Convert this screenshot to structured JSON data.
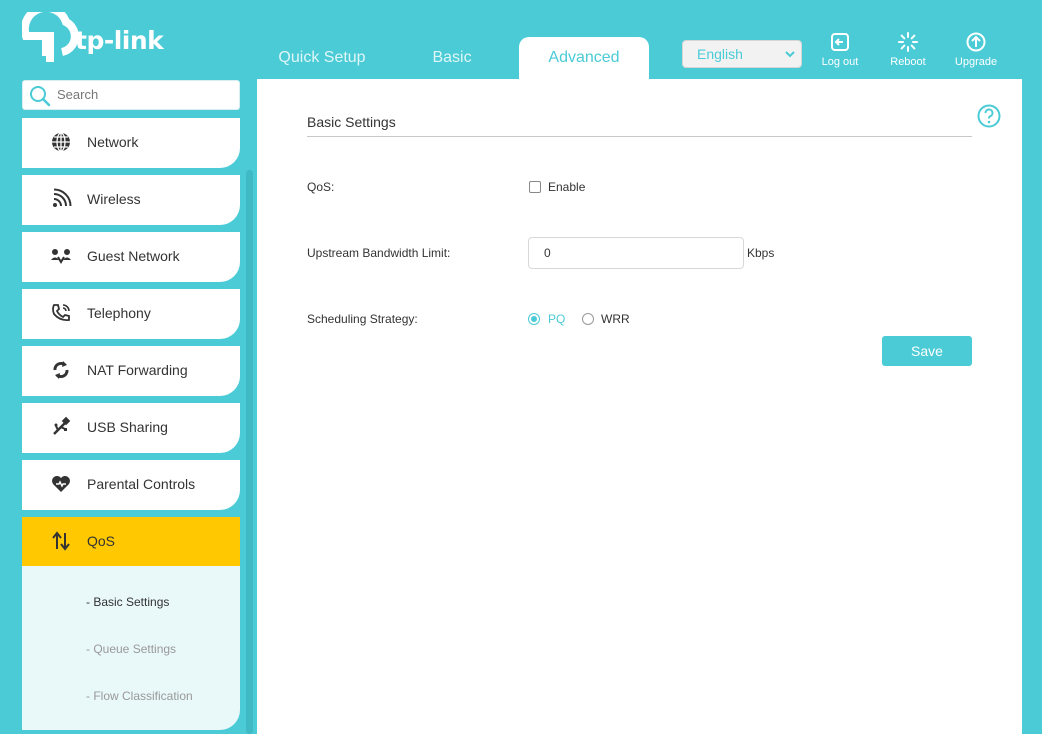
{
  "brand": {
    "logo_text": "tp-link",
    "accent": "#4acbd6",
    "active_nav": "#ffc800"
  },
  "tabs": [
    {
      "label": "Quick Setup"
    },
    {
      "label": "Basic"
    },
    {
      "label": "Advanced",
      "active": true
    }
  ],
  "header": {
    "language": "English",
    "logout_label": "Log out",
    "reboot_label": "Reboot",
    "upgrade_label": "Upgrade"
  },
  "sidebar": {
    "search_placeholder": "Search",
    "items": [
      {
        "label": "Network",
        "icon": "globe-icon"
      },
      {
        "label": "Wireless",
        "icon": "wifi-icon"
      },
      {
        "label": "Guest Network",
        "icon": "guest-network-icon"
      },
      {
        "label": "Telephony",
        "icon": "phone-icon"
      },
      {
        "label": "NAT Forwarding",
        "icon": "nat-forwarding-icon"
      },
      {
        "label": "USB Sharing",
        "icon": "usb-icon"
      },
      {
        "label": "Parental Controls",
        "icon": "heart-icon"
      },
      {
        "label": "QoS",
        "icon": "updown-arrows-icon",
        "active": true
      }
    ],
    "sub_items": [
      {
        "label": "- Basic Settings",
        "active": true
      },
      {
        "label": "- Queue Settings"
      },
      {
        "label": "- Flow Classification"
      }
    ]
  },
  "main": {
    "section_title": "Basic Settings",
    "qos_label": "QoS:",
    "enable_label": "Enable",
    "upstream_label": "Upstream Bandwidth Limit:",
    "upstream_value": "0",
    "upstream_unit": "Kbps",
    "strategy_label": "Scheduling Strategy:",
    "strategy_options": [
      "PQ",
      "WRR"
    ],
    "strategy_selected": "PQ",
    "save_label": "Save"
  }
}
